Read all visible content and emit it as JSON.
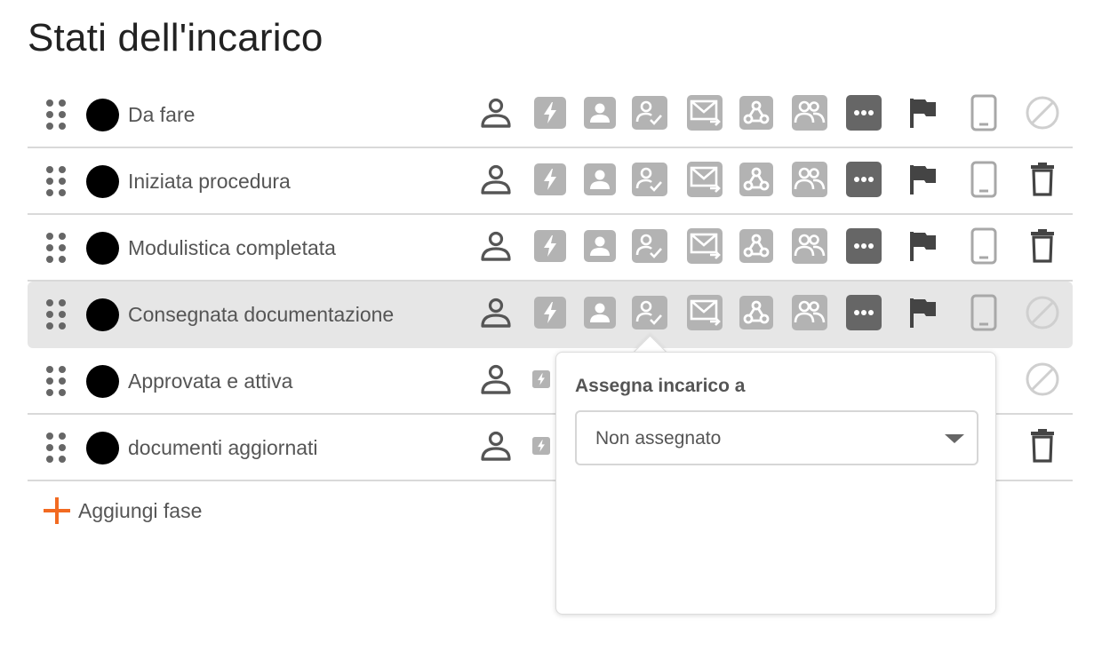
{
  "page": {
    "title": "Stati dell'incarico"
  },
  "icons": [
    {
      "key": "assignee",
      "name": "person-outline-icon"
    },
    {
      "key": "auto",
      "name": "lightning-icon"
    },
    {
      "key": "contact",
      "name": "contact-card-icon"
    },
    {
      "key": "approver",
      "name": "user-check-icon"
    },
    {
      "key": "email",
      "name": "email-send-icon"
    },
    {
      "key": "webhook",
      "name": "webhook-icon"
    },
    {
      "key": "group",
      "name": "users-group-icon"
    },
    {
      "key": "more",
      "name": "more-icon"
    },
    {
      "key": "flag",
      "name": "flag-icon"
    },
    {
      "key": "mobile",
      "name": "mobile-phone-icon"
    },
    {
      "key": "action",
      "name": "row-action-icon"
    }
  ],
  "phases": [
    {
      "label": "Da fare",
      "color": "#000000",
      "action": "disabled"
    },
    {
      "label": "Iniziata procedura",
      "color": "#000000",
      "action": "delete"
    },
    {
      "label": "Modulistica completata",
      "color": "#000000",
      "action": "delete"
    },
    {
      "label": "Consegnata documentazione",
      "color": "#000000",
      "action": "disabled"
    },
    {
      "label": "Approvata e attiva",
      "color": "#000000",
      "action": "disabled"
    },
    {
      "label": "documenti aggiornati",
      "color": "#000000",
      "action": "delete"
    }
  ],
  "active_row_index": 3,
  "add_phase": {
    "label": "Aggiungi fase"
  },
  "popover": {
    "title": "Assegna incarico a",
    "select_value": "Non assegnato"
  },
  "colors": {
    "accent": "#f26a21",
    "icon_gray": "#b3b3b3",
    "icon_dark": "#555555"
  }
}
